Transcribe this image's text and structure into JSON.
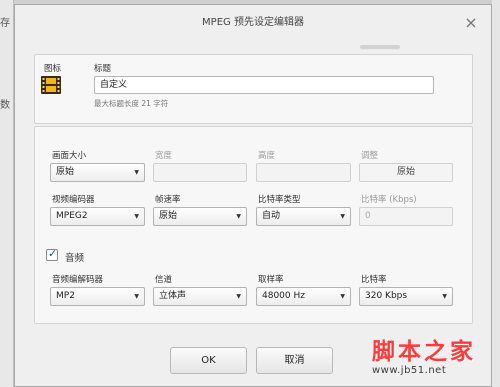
{
  "background": {
    "left_glyph_top": "存",
    "left_glyph_mid": "数"
  },
  "dialog": {
    "title": "MPEG 预先设定编辑器"
  },
  "icon_section": {
    "icon_label": "图标",
    "title_label": "标题",
    "title_value": "自定义",
    "title_hint": "最大标题长度 21 字符"
  },
  "video": {
    "frame_size_label": "画面大小",
    "frame_size_value": "原始",
    "width_label": "宽度",
    "height_label": "高度",
    "adjust_label": "调整",
    "adjust_button": "原始",
    "codec_label": "视频编码器",
    "codec_value": "MPEG2",
    "framerate_label": "帧速率",
    "framerate_value": "原始",
    "bitrate_type_label": "比特率类型",
    "bitrate_type_value": "自动",
    "bitrate_label": "比特率 (Kbps)",
    "bitrate_value": "0"
  },
  "audio": {
    "checkbox_label": "音频",
    "checked": true,
    "codec_label": "音频编解码器",
    "codec_value": "MP2",
    "channels_label": "信道",
    "channels_value": "立体声",
    "samplerate_label": "取样率",
    "samplerate_value": "48000 Hz",
    "bitrate_label": "比特率",
    "bitrate_value": "320 Kbps"
  },
  "buttons": {
    "ok": "OK",
    "cancel": "取消"
  },
  "watermark": {
    "text": "脚本之家",
    "url": "www.jb51.net"
  },
  "colors": {
    "watermark_red": "#ff3a3a",
    "checkbox_mark": "#1f4f8c"
  },
  "icons": {
    "dropdown": "chevron-down-icon",
    "preset": "film-icon"
  }
}
